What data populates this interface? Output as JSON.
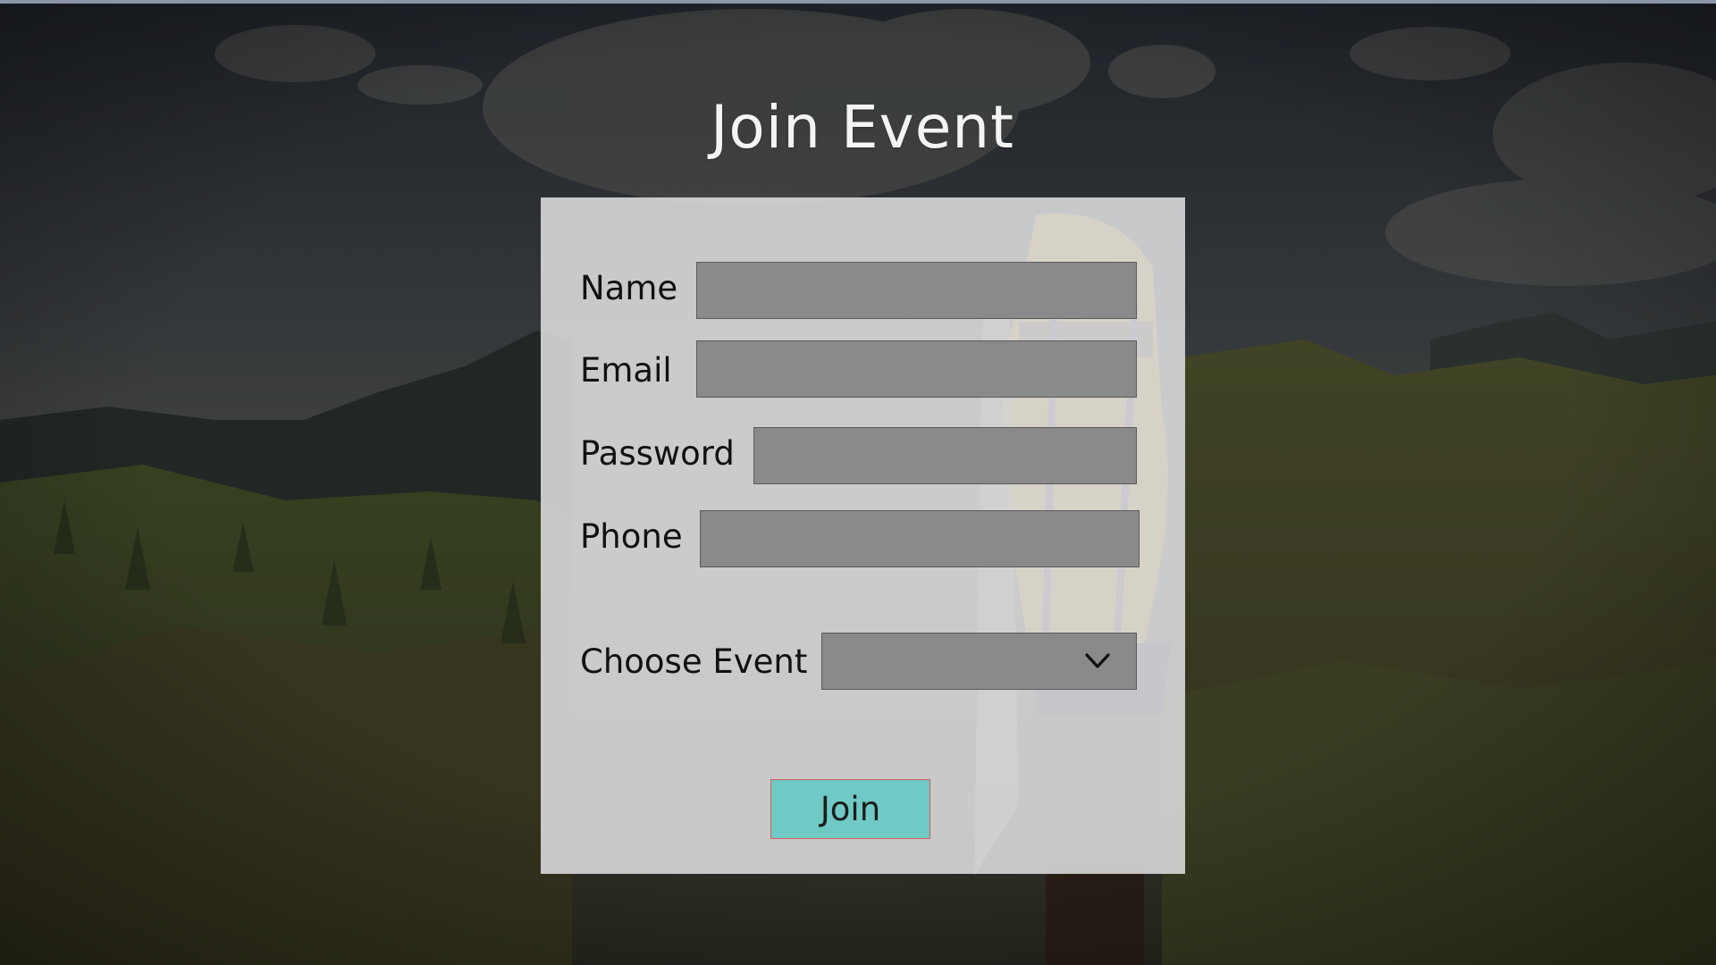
{
  "window": {
    "title": "Join Event"
  },
  "form": {
    "fields": [
      {
        "label": "Name",
        "value": "",
        "placeholder": ""
      },
      {
        "label": "Email",
        "value": "",
        "placeholder": ""
      },
      {
        "label": "Password",
        "value": "",
        "placeholder": ""
      },
      {
        "label": "Phone",
        "value": "",
        "placeholder": ""
      }
    ],
    "event_select": {
      "label": "Choose Event",
      "selected": "",
      "icon": "chevron-down-icon"
    },
    "submit_label": "Join"
  },
  "colors": {
    "panel": "#e2e2e4",
    "field": "#8a8a8a",
    "button": "#6fc9c4",
    "button_border": "#d85a5a",
    "title_text": "#f4f4f4"
  }
}
